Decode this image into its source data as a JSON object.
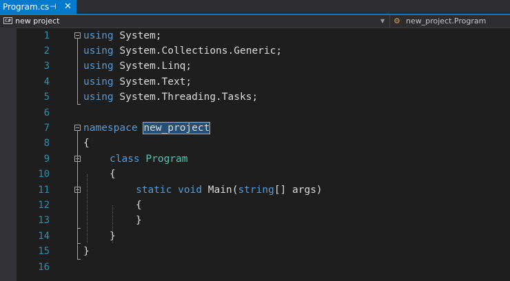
{
  "tab": {
    "title": "Program.cs",
    "pin_glyph": "⊣",
    "close_glyph": "✕"
  },
  "navbar": {
    "project_icon_text": "C#",
    "project": "new project",
    "dropdown_glyph": "▼",
    "class_icon": "class-icon",
    "class": "new_project.Program"
  },
  "editor": {
    "line_numbers": [
      "1",
      "2",
      "3",
      "4",
      "5",
      "6",
      "7",
      "8",
      "9",
      "10",
      "11",
      "12",
      "13",
      "14",
      "15",
      "16"
    ],
    "lines": {
      "l1": {
        "kw": "using",
        "rest": " System;"
      },
      "l2": {
        "kw": "using",
        "rest": " System.Collections.Generic;"
      },
      "l3": {
        "kw": "using",
        "rest": " System.Linq;"
      },
      "l4": {
        "kw": "using",
        "rest": " System.Text;"
      },
      "l5": {
        "kw": "using",
        "rest": " System.Threading.Tasks;"
      },
      "l7": {
        "kw": "namespace",
        "space": " ",
        "name": "new_project"
      },
      "l8": {
        "text": "{"
      },
      "l9": {
        "kw": "class",
        "space": " ",
        "name": "Program"
      },
      "l10": {
        "text": "{"
      },
      "l11": {
        "kw1": "static",
        "s1": " ",
        "kw2": "void",
        "mid": " Main(",
        "kw3": "string",
        "rest": "[] args)"
      },
      "l12": {
        "text": "{"
      },
      "l13": {
        "text": "}"
      },
      "l14": {
        "text": "}"
      },
      "l15": {
        "text": "}"
      }
    }
  },
  "colors": {
    "keyword": "#569cd6",
    "type": "#4ec9b0",
    "text": "#dcdcdc",
    "line_number": "#2b91af",
    "selection": "#264f78",
    "accent": "#007acc"
  }
}
